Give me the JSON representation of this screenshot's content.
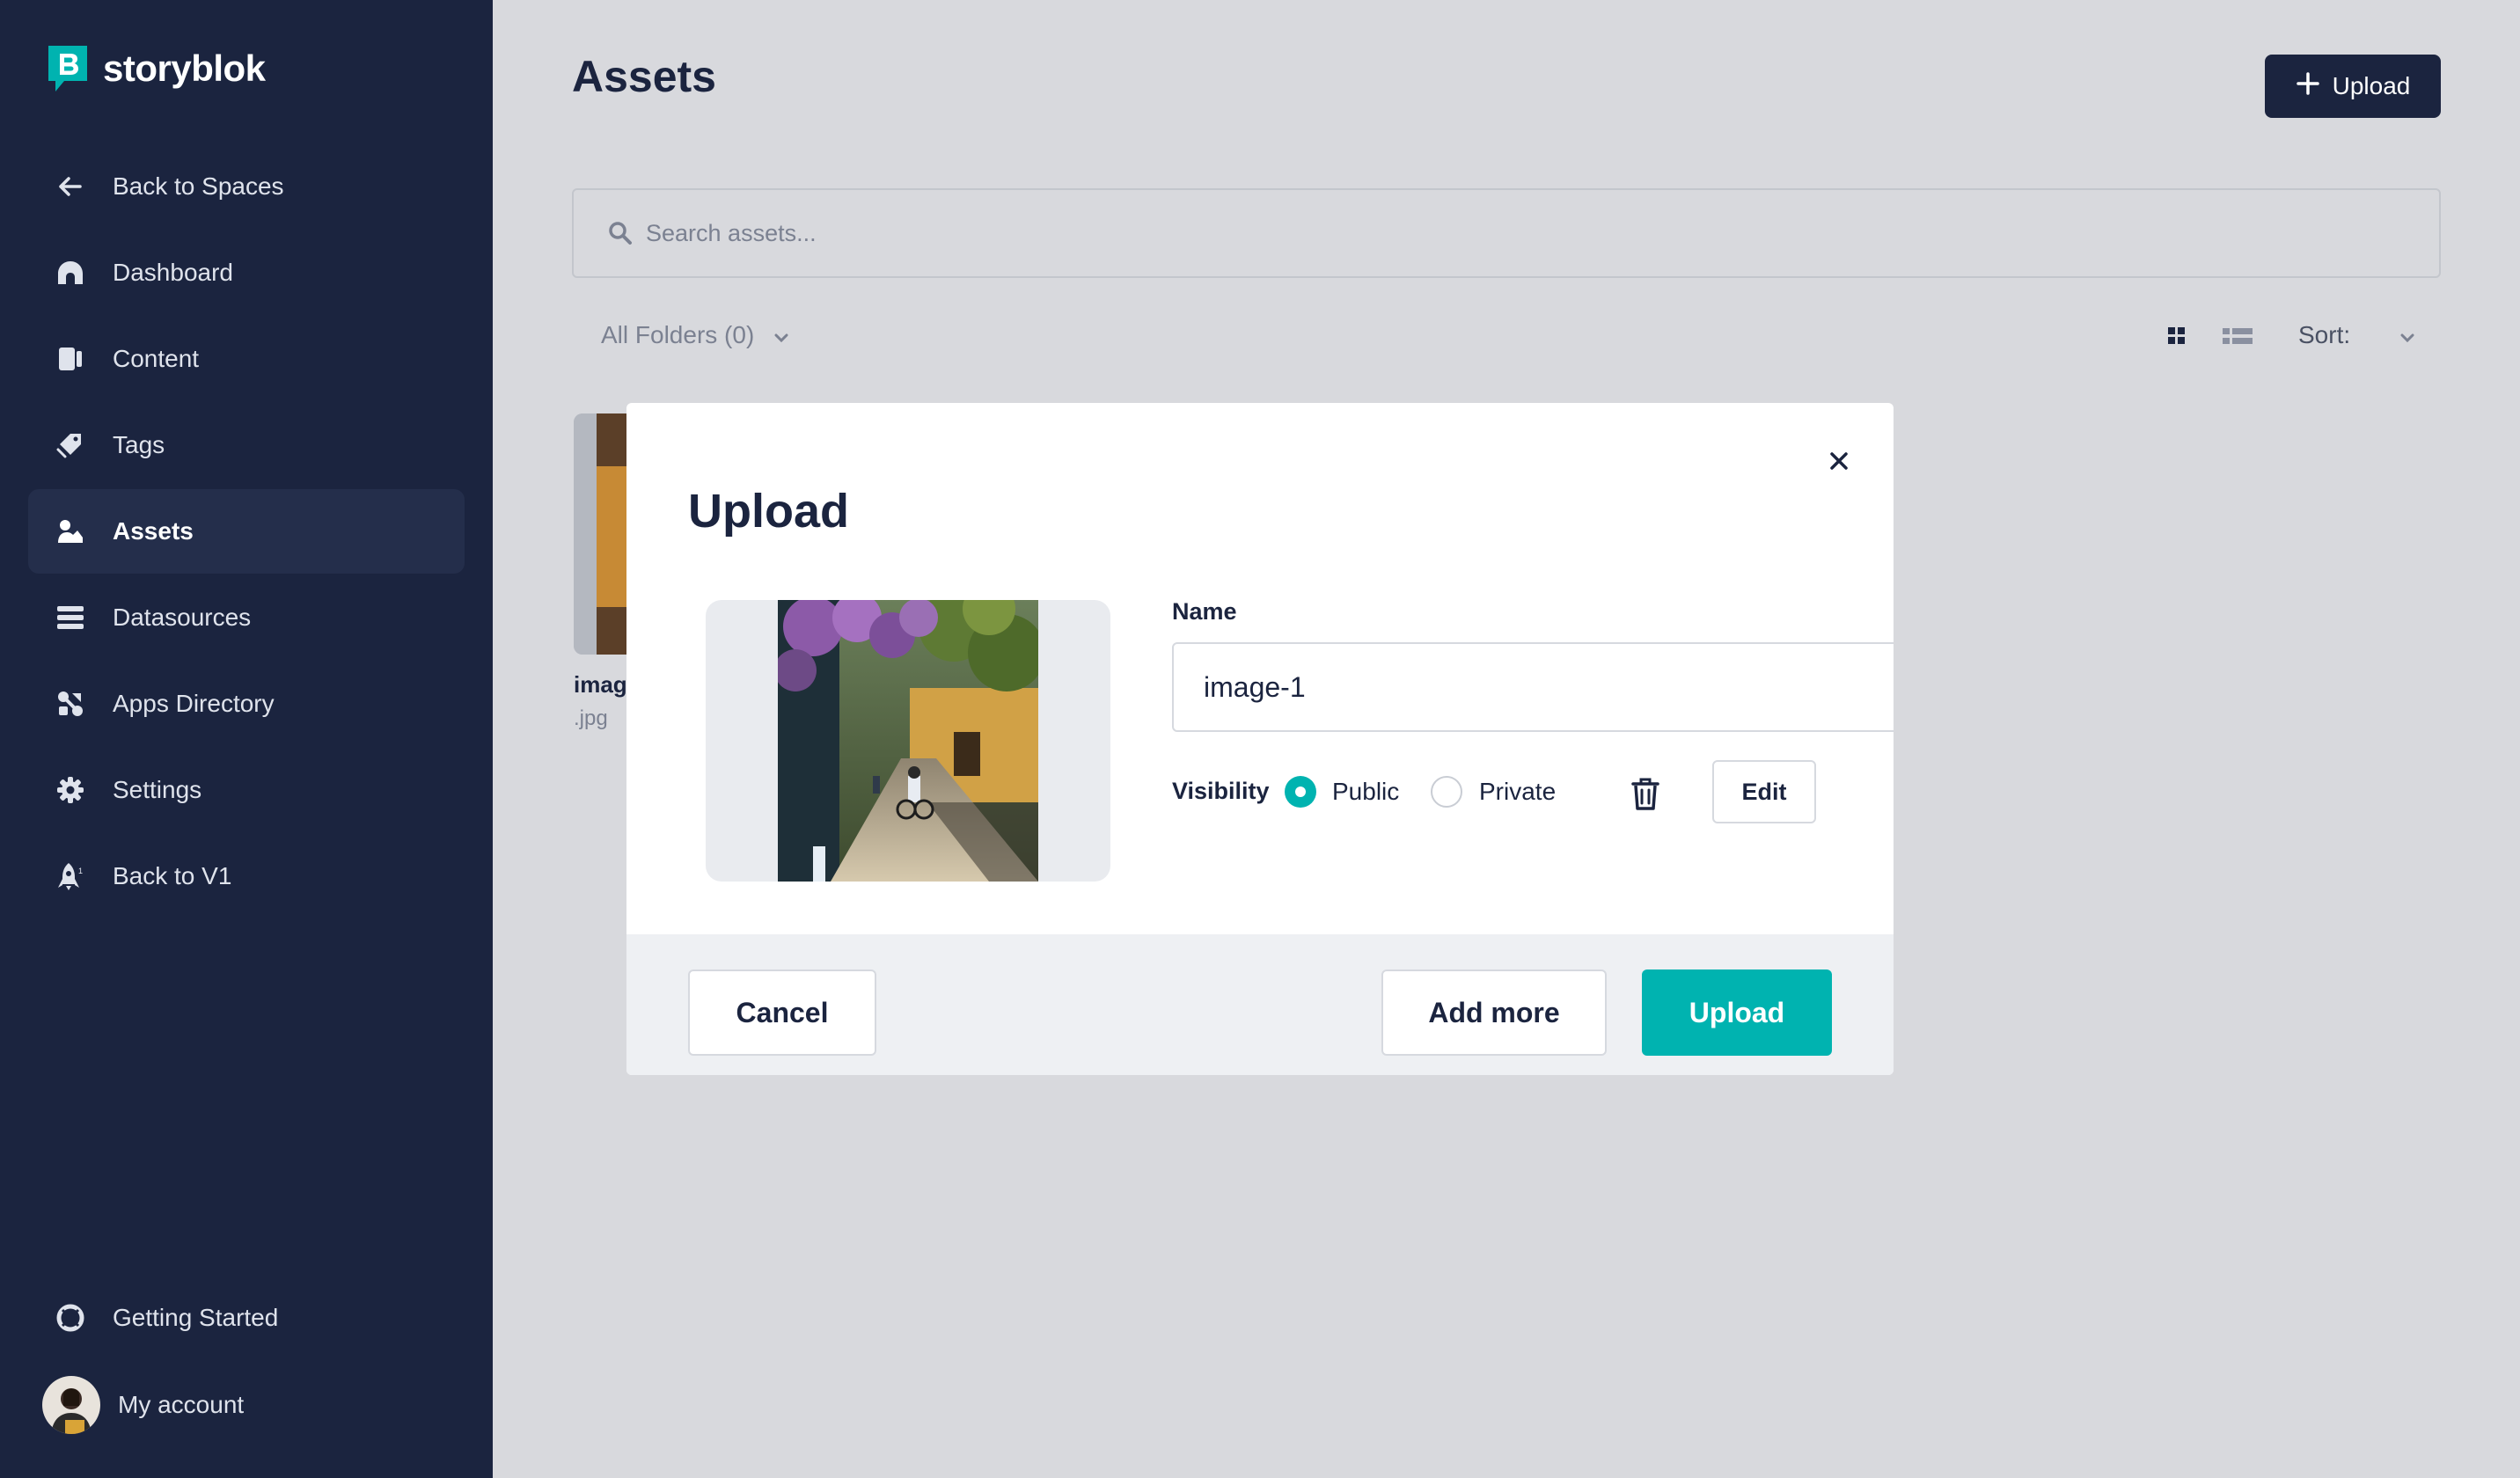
{
  "brand": {
    "name": "storyblok",
    "accent": "#00b3b0",
    "sidebar_bg": "#1b243f"
  },
  "sidebar": {
    "items": [
      {
        "label": "Back to Spaces",
        "icon": "arrow-left-icon"
      },
      {
        "label": "Dashboard",
        "icon": "dashboard-icon"
      },
      {
        "label": "Content",
        "icon": "content-icon"
      },
      {
        "label": "Tags",
        "icon": "tag-icon"
      },
      {
        "label": "Assets",
        "icon": "assets-icon",
        "active": true
      },
      {
        "label": "Datasources",
        "icon": "datasources-icon"
      },
      {
        "label": "Apps Directory",
        "icon": "apps-icon"
      },
      {
        "label": "Settings",
        "icon": "gear-icon"
      },
      {
        "label": "Back to V1",
        "icon": "rocket-icon"
      }
    ],
    "getting_started": "Getting Started",
    "account": "My account"
  },
  "header": {
    "title": "Assets",
    "upload_label": "Upload"
  },
  "search": {
    "placeholder": "Search assets..."
  },
  "filters": {
    "folders": "All Folders (0)",
    "sort_label": "Sort:"
  },
  "asset": {
    "name": "imag",
    "ext": ".jpg"
  },
  "modal": {
    "title": "Upload",
    "name_label": "Name",
    "name_value": "image-1",
    "extension": "jpg",
    "visibility_label": "Visibility",
    "public_label": "Public",
    "private_label": "Private",
    "selected_visibility": "Public",
    "edit_label": "Edit",
    "cancel_label": "Cancel",
    "add_more_label": "Add more",
    "upload_label": "Upload"
  }
}
